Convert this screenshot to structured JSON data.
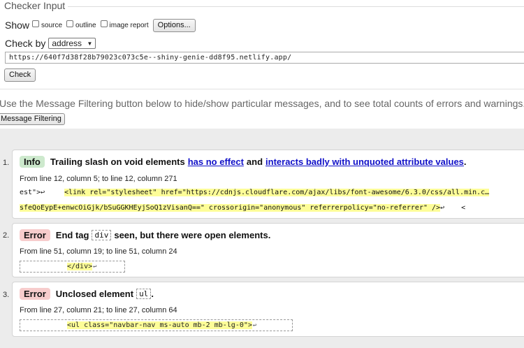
{
  "checker": {
    "legend": "Checker Input",
    "show_label": "Show",
    "options": [
      {
        "label": "source",
        "checked": false
      },
      {
        "label": "outline",
        "checked": false
      },
      {
        "label": "image report",
        "checked": false
      }
    ],
    "options_button": "Options...",
    "check_by_label": "Check by",
    "check_by_value": "address",
    "url": "https://640f7d38f28b79023c073c5e--shiny-genie-dd8f95.netlify.app/",
    "check_button": "Check"
  },
  "filter": {
    "help_text": "Use the Message Filtering button below to hide/show particular messages, and to see total counts of errors and warnings.",
    "button": "Message Filtering"
  },
  "messages": [
    {
      "number": "1.",
      "type": "Info",
      "text1": "Trailing slash on void elements",
      "link1": "has no effect",
      "text2": "and",
      "link2": "interacts badly with unquoted attribute values",
      "text3": ".",
      "location": "From line 12, column 5; to line 12, column 271",
      "extract_line1_pre": "est\">↩",
      "extract_line1_hl": "<link rel=\"stylesheet\" href=\"https://cdnjs.cloudflare.com/ajax/libs/font-awesome/6.3.0/css/all.min.c…",
      "extract_line2_hl": "sfeQoEypE+enwcOiGjk/bSuGGKHEyjSoQ1zVisanQ==\" crossorigin=\"anonymous\" referrerpolicy=\"no-referrer\" />",
      "extract_line2_post": "↩    <"
    },
    {
      "number": "2.",
      "type": "Error",
      "text1": "End tag",
      "code": "div",
      "text2": "seen, but there were open elements.",
      "location": "From line 51, column 19; to line 51, column 24",
      "extract": "</div>"
    },
    {
      "number": "3.",
      "type": "Error",
      "text1": "Unclosed element",
      "code": "ul",
      "text2": ".",
      "location": "From line 27, column 21; to line 27, column 64",
      "extract": "<ul class=\"navbar-nav ms-auto mb-2 mb-lg-0\">"
    }
  ]
}
